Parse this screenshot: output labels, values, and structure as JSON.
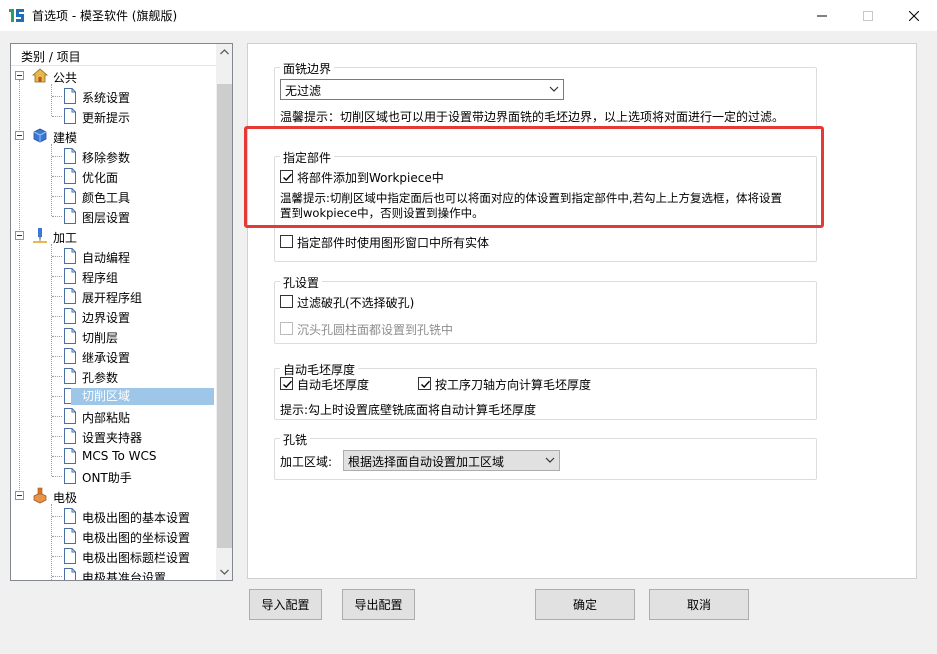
{
  "window": {
    "title": "首选项 - 模圣软件 (旗舰版)"
  },
  "tree": {
    "header": "类别 / 项目",
    "categories": [
      {
        "label": "公共",
        "icon": "house-icon",
        "items": [
          "系统设置",
          "更新提示"
        ]
      },
      {
        "label": "建模",
        "icon": "cube-icon",
        "items": [
          "移除参数",
          "优化面",
          "颜色工具",
          "图层设置"
        ]
      },
      {
        "label": "加工",
        "icon": "machining-tool-icon",
        "items": [
          "自动编程",
          "程序组",
          "展开程序组",
          "边界设置",
          "切削层",
          "继承设置",
          "孔参数",
          "切削区域",
          "内部粘贴",
          "设置夹持器",
          "MCS To WCS",
          "ONT助手"
        ]
      },
      {
        "label": "电极",
        "icon": "electrode-icon",
        "items": [
          "电极出图的基本设置",
          "电极出图的坐标设置",
          "电极出图标题栏设置",
          "电极基准台设置"
        ]
      }
    ],
    "selected": "切削区域"
  },
  "face_milling_boundary": {
    "title": "面铣边界",
    "filter_value": "无过滤",
    "tip": "温馨提示：切削区域也可以用于设置带边界面铣的毛坯边界，以上选项将对面进行一定的过滤。"
  },
  "specify_part": {
    "title": "指定部件",
    "add_to_workpiece_label": "将部件添加到Workpiece中",
    "add_to_workpiece_checked": true,
    "tip_line1": "温馨提示:切削区域中指定面后也可以将面对应的体设置到指定部件中,若勾上上方复选框，体将设置",
    "tip_line2": "置到wokpiece中，否则设置到操作中。",
    "use_all_bodies_label": "指定部件时使用图形窗口中所有实体",
    "use_all_bodies_checked": false
  },
  "hole_settings": {
    "title": "孔设置",
    "filter_broken_label": "过滤破孔(不选择破孔)",
    "filter_broken_checked": false,
    "counterbore_label": "沉头孔圆柱面都设置到孔铣中",
    "counterbore_checked": false
  },
  "auto_blank_thickness": {
    "title": "自动毛坯厚度",
    "auto_label": "自动毛坯厚度",
    "auto_checked": true,
    "by_tool_axis_label": "按工序刀轴方向计算毛坯厚度",
    "by_tool_axis_checked": true,
    "tip": "提示:勾上时设置底壁铣底面将自动计算毛坯厚度"
  },
  "hole_milling": {
    "title": "孔铣",
    "area_label": "加工区域:",
    "area_value": "根据选择面自动设置加工区域"
  },
  "buttons": {
    "import": "导入配置",
    "export": "导出配置",
    "ok": "确定",
    "cancel": "取消"
  },
  "colors": {
    "highlight_border": "#e53935",
    "selection": "#9dc6e8"
  }
}
